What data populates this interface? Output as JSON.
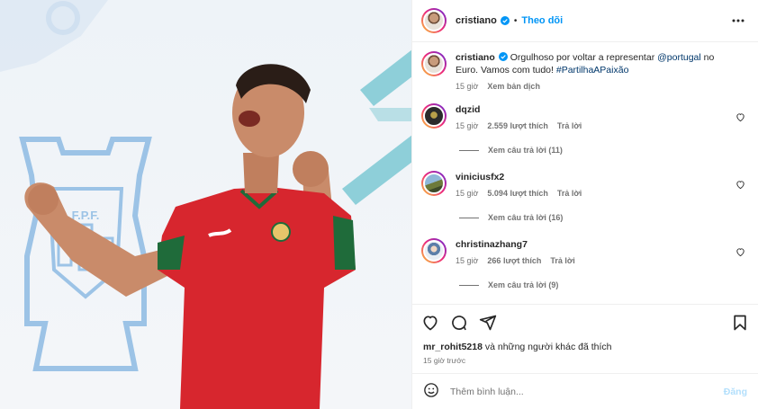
{
  "post": {
    "image_alt": "Footballer in red jersey celebrating in front of F.P.F. crest",
    "crest_text": "F.P.F.",
    "author": "cristiano",
    "follow_label": "Theo dõi",
    "dot": "•"
  },
  "caption": {
    "username": "cristiano",
    "text_before": "Orgulhoso por voltar a representar ",
    "mention": "@portugal",
    "text_middle": " no Euro. Vamos com tudo! ",
    "hashtag": "#PartilhaAPaixão",
    "time": "15 giờ",
    "translate_label": "Xem bản dịch"
  },
  "comments": [
    {
      "username": "dqzid",
      "time": "15 giờ",
      "likes": "2.559 lượt thích",
      "reply": "Trả lời",
      "view_replies": "Xem câu trả lời (11)"
    },
    {
      "username": "viniciusfx2",
      "time": "15 giờ",
      "likes": "5.094 lượt thích",
      "reply": "Trả lời",
      "view_replies": "Xem câu trả lời (16)"
    },
    {
      "username": "christinazhang7",
      "time": "15 giờ",
      "likes": "266 lượt thích",
      "reply": "Trả lời",
      "view_replies": "Xem câu trả lời (9)"
    }
  ],
  "likes": {
    "first_user": "mr_rohit5218",
    "rest": " và những người khác đã thích"
  },
  "post_time": "15 giờ trước",
  "composer": {
    "placeholder": "Thêm bình luận...",
    "post_label": "Đăng"
  },
  "icons": {
    "verified": "verified-badge-icon",
    "more": "more-options-icon",
    "like": "heart-icon",
    "comment": "comment-icon",
    "share": "share-icon",
    "save": "bookmark-icon",
    "emoji": "emoji-icon"
  },
  "colors": {
    "link_blue": "#0095f6",
    "mention_blue": "#00376b",
    "secondary_text": "#737373",
    "jersey_red": "#d7262e",
    "crest_blue": "#9cc3e6"
  }
}
